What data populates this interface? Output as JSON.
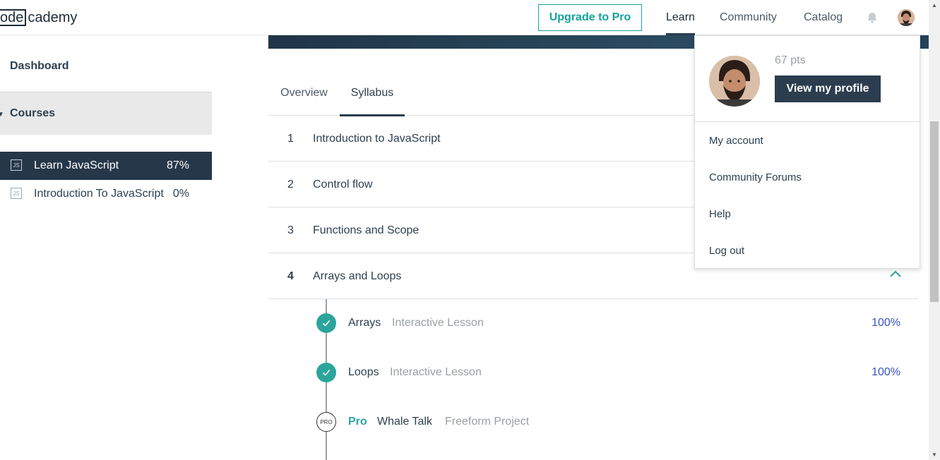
{
  "header": {
    "logo_boxed": "ode",
    "logo_rest": "cademy",
    "upgrade_label": "Upgrade to Pro",
    "nav": [
      {
        "label": "Learn",
        "active": true
      },
      {
        "label": "Community",
        "active": false
      },
      {
        "label": "Catalog",
        "active": false
      }
    ]
  },
  "sidebar": {
    "dashboard_label": "Dashboard",
    "courses_label": "Courses",
    "courses": [
      {
        "icon_text": "JS",
        "name": "Learn JavaScript",
        "percent": "87%",
        "active": true
      },
      {
        "icon_text": "JS",
        "name": "Introduction To JavaScript",
        "percent": "0%",
        "active": false
      }
    ]
  },
  "tabs": [
    {
      "label": "Overview",
      "active": false
    },
    {
      "label": "Syllabus",
      "active": true
    }
  ],
  "syllabus": [
    {
      "num": "1",
      "title": "Introduction to JavaScript"
    },
    {
      "num": "2",
      "title": "Control flow"
    },
    {
      "num": "3",
      "title": "Functions and Scope"
    },
    {
      "num": "4",
      "title": "Arrays and Loops",
      "expanded": true
    }
  ],
  "lessons": [
    {
      "name": "Arrays",
      "type": "Interactive Lesson",
      "percent": "100%",
      "status": "complete"
    },
    {
      "name": "Loops",
      "type": "Interactive Lesson",
      "percent": "100%",
      "status": "complete"
    },
    {
      "badge": "PRO",
      "tag": "Pro",
      "name": "Whale Talk",
      "type": "Freeform Project",
      "status": "pro"
    }
  ],
  "profile_menu": {
    "points": "67 pts",
    "view_profile_label": "View my profile",
    "items": [
      "My account",
      "Community Forums",
      "Help",
      "Log out"
    ]
  },
  "colors": {
    "accent": "#15a49a",
    "dark": "#2b3d4e",
    "complete": "#2ba59c",
    "percent": "#3a55c4"
  }
}
